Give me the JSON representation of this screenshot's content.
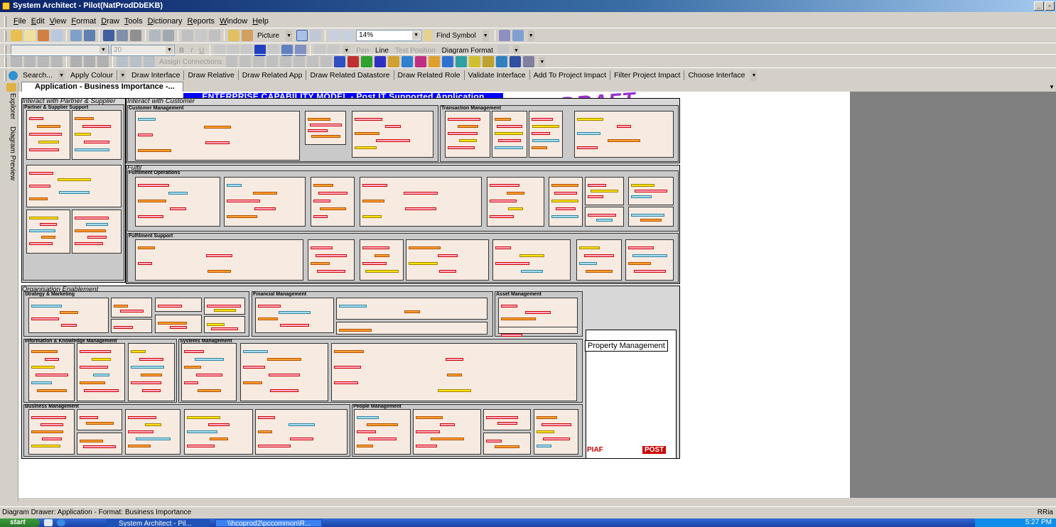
{
  "window": {
    "title": "System Architect - Pilot(NatProdDbEKB)",
    "min_glyph": "_",
    "restore_glyph": "▫"
  },
  "menu": [
    "File",
    "Edit",
    "View",
    "Format",
    "Draw",
    "Tools",
    "Dictionary",
    "Reports",
    "Window",
    "Help"
  ],
  "toolbar1": {
    "picture_label": "Picture",
    "zoom_value": "14%",
    "find_symbol_label": "Find Symbol"
  },
  "toolbar2": {
    "font_size_value": "20",
    "pen_label": "Pen",
    "line_label": "Line",
    "text_position_label": "Text Position",
    "diagram_format_label": "Diagram Format"
  },
  "toolbar3": {
    "assign_connections_label": "Assign Connections"
  },
  "commandbar": {
    "search_label": "Search...",
    "items": [
      "Apply Colour",
      "Draw Interface",
      "Draw Relative",
      "Draw Related App",
      "Draw Related Datastore",
      "Draw Related Role",
      "Validate Interface",
      "Add To Project Impact",
      "Filter Project Impact",
      "Choose Interface"
    ]
  },
  "document_tab": {
    "label": "Application - Business Importance -..."
  },
  "side_tabs": {
    "explorer": "Explorer",
    "diagram_preview": "Diagram Preview"
  },
  "diagram": {
    "banner": "ENTERPRISE CAPABILITY MODEL - Post IT Supported Application",
    "draft_stamp": "DRAFT",
    "zones": {
      "partner": "Interact with Partner & Supplier",
      "customer": "Interact with Customer",
      "fulfil": "Fulfil",
      "org": "Organisation Enablement"
    },
    "groups": {
      "partner_support": "Partner & Supplier Support",
      "customer_mgmt": "Customer Management",
      "transaction_mgmt": "Transaction Management",
      "fulfilment_ops": "Fulfilment Operations",
      "fulfilment_support": "Fulfilment Support",
      "strategy": "Strategy & Marketing",
      "financial": "Financial Management",
      "asset": "Asset Management",
      "information": "Information & Knowledge Management",
      "systems": "Systems Management",
      "business": "Business Management",
      "people": "People Management"
    },
    "property_management": "Property Management",
    "logo_piaf": "PIAF",
    "logo_post": "POST"
  },
  "status": {
    "text": "Diagram Drawer: Application - Format: Business Importance",
    "right": "RRia"
  },
  "taskbar": {
    "start": "start",
    "items": [
      "System Architect - Pil...",
      "\\\\hcoprod2\\pccommon\\R..."
    ],
    "clock": "5:27 PM"
  },
  "colors": {
    "title_gradient_start": "#0a246a",
    "banner": "#0000ff",
    "draft": "#9933cc",
    "app_pink": "#ffb0c8",
    "app_orange": "#ffa032"
  }
}
